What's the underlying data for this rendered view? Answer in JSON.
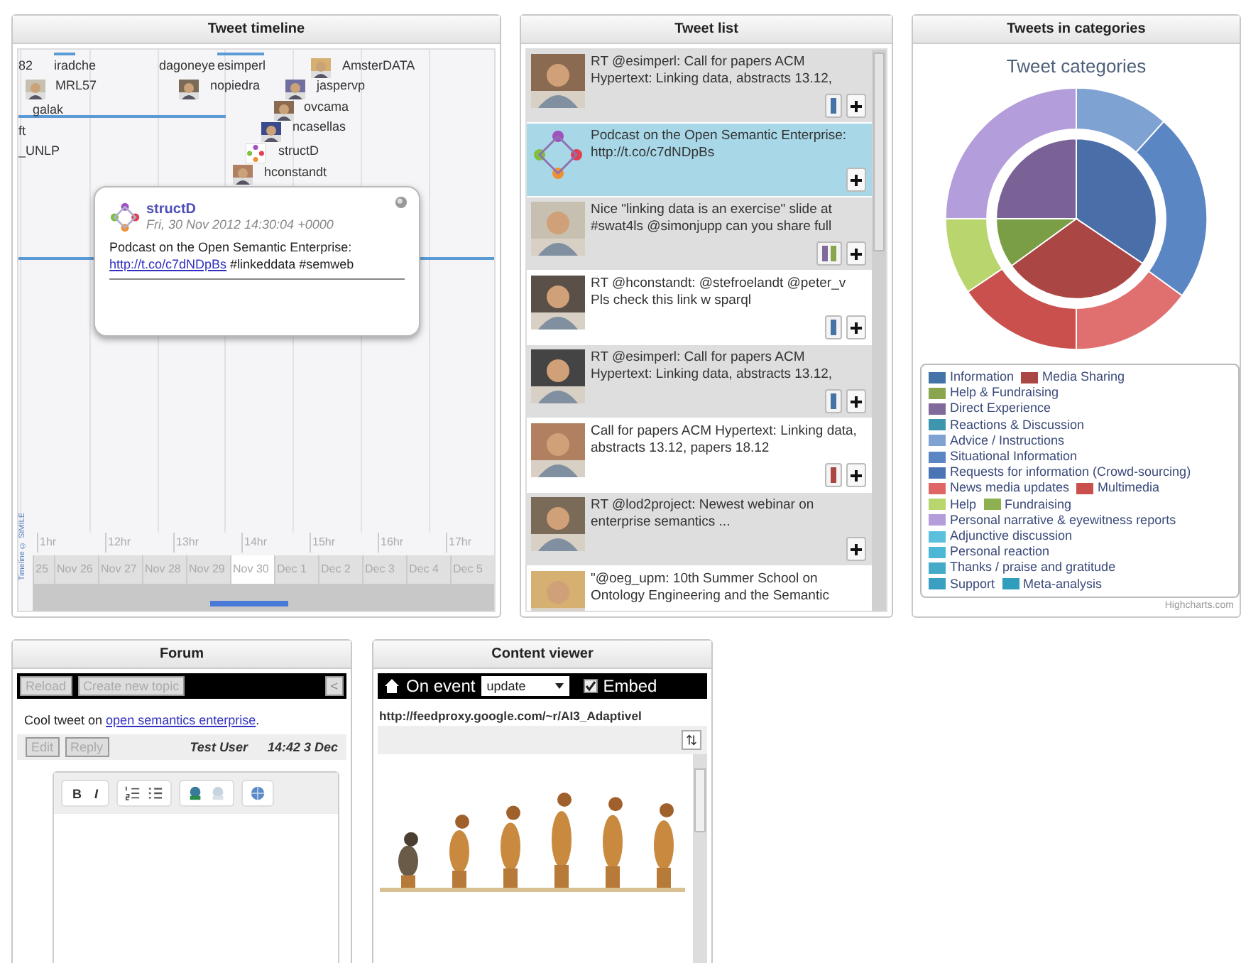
{
  "timeline": {
    "title": "Tweet timeline",
    "events": [
      {
        "label": "82"
      },
      {
        "label": "iradche"
      },
      {
        "label": "MRL57"
      },
      {
        "label": "galak"
      },
      {
        "label": "dagoneye"
      },
      {
        "label": "esimperl"
      },
      {
        "label": "nopiedra"
      },
      {
        "label": "AmsterDATA"
      },
      {
        "label": "jaspervp"
      },
      {
        "label": "ovcama"
      },
      {
        "label": "ncasellas"
      },
      {
        "label": "ft"
      },
      {
        "label": "_UNLP"
      },
      {
        "label": "structD"
      },
      {
        "label": "hconstandt"
      }
    ],
    "popup": {
      "user": "structD",
      "date": "Fri, 30 Nov 2012 14:30:04 +0000",
      "text": "Podcast on the Open Semantic Enterprise: ",
      "link": "http://t.co/c7dNDpBs",
      "after": " #linkeddata #semweb"
    },
    "hour_ticks": [
      "1hr",
      "12hr",
      "13hr",
      "14hr",
      "15hr",
      "16hr",
      "17hr"
    ],
    "date_ticks": [
      {
        "label": "25",
        "selected": false
      },
      {
        "label": "Nov 26",
        "selected": false
      },
      {
        "label": "Nov 27",
        "selected": false
      },
      {
        "label": "Nov 28",
        "selected": false
      },
      {
        "label": "Nov 29",
        "selected": false
      },
      {
        "label": "Nov 30",
        "selected": true
      },
      {
        "label": "Dec 1",
        "selected": false
      },
      {
        "label": "Dec 2",
        "selected": false
      },
      {
        "label": "Dec 3",
        "selected": false
      },
      {
        "label": "Dec 4",
        "selected": false
      },
      {
        "label": "Dec 5",
        "selected": false
      }
    ],
    "credit": "Timeline © SIMILE"
  },
  "tweet_list": {
    "title": "Tweet list",
    "items": [
      {
        "text": "RT @esimperl: Call for papers ACM Hypertext: Linking data, abstracts 13.12,",
        "tags": [
          {
            "color": "#4572a7"
          }
        ],
        "selected": false
      },
      {
        "kind": "logo",
        "text": "Podcast on the Open Semantic Enterprise: http://t.co/c7dNDpBs",
        "selected": true
      },
      {
        "text": "Nice \"linking data is an exercise\" slide at #swat4ls @simonjupp can you share full",
        "tags": [
          {
            "color": "#80699b"
          },
          {
            "color": "#89a54e"
          }
        ],
        "selected": false
      },
      {
        "text": "RT @hconstandt: @stefroelandt @peter_v Pls check this link w sparql",
        "tags": [
          {
            "color": "#4572a7"
          }
        ],
        "selected": false
      },
      {
        "text": "RT @esimperl: Call for papers ACM Hypertext: Linking data, abstracts 13.12,",
        "tags": [
          {
            "color": "#4572a7"
          }
        ],
        "selected": false
      },
      {
        "text": "Call for papers ACM Hypertext: Linking data, abstracts 13.12, papers 18.12",
        "tags": [
          {
            "color": "#aa4643"
          }
        ],
        "selected": false
      },
      {
        "text": "RT @lod2project: Newest webinar on enterprise semantics ...",
        "selected": false
      },
      {
        "text": "\"@oeg_upm: 10th Summer School on Ontology Engineering and the Semantic",
        "selected": false
      }
    ]
  },
  "categories": {
    "title": "Tweets in categories",
    "chart_title": "Tweet categories",
    "legend": [
      [
        {
          "label": "Information",
          "color": "#4572a7"
        },
        {
          "label": "Media Sharing",
          "color": "#aa4643"
        }
      ],
      [
        {
          "label": "Help & Fundraising",
          "color": "#89a54e"
        }
      ],
      [
        {
          "label": "Direct Experience",
          "color": "#80699b"
        }
      ],
      [
        {
          "label": "Reactions & Discussion",
          "color": "#3d96ae"
        }
      ],
      [
        {
          "label": "Advice / Instructions",
          "color": "#7ea3d3"
        }
      ],
      [
        {
          "label": "Situational Information",
          "color": "#5b86c4"
        }
      ],
      [
        {
          "label": "Requests for information (Crowd-sourcing)",
          "color": "#4a74b3"
        }
      ],
      [
        {
          "label": "News media updates",
          "color": "#e06666"
        },
        {
          "label": "Multimedia",
          "color": "#c9504c"
        }
      ],
      [
        {
          "label": "Help",
          "color": "#b9d66e"
        },
        {
          "label": "Fundraising",
          "color": "#8db050"
        }
      ],
      [
        {
          "label": "Personal narrative & eyewitness reports",
          "color": "#b39ddb"
        }
      ],
      [
        {
          "label": "Adjunctive discussion",
          "color": "#5bc0de"
        }
      ],
      [
        {
          "label": "Personal reaction",
          "color": "#4db8d6"
        }
      ],
      [
        {
          "label": "Thanks / praise and gratitude",
          "color": "#45aac8"
        }
      ],
      [
        {
          "label": "Support",
          "color": "#3a9fc0"
        },
        {
          "label": "Meta-analysis",
          "color": "#2f9dbb"
        }
      ]
    ],
    "credit": "Highcharts.com"
  },
  "forum": {
    "title": "Forum",
    "toolbar": [
      {
        "label": "Reload",
        "disabled": true
      },
      {
        "label": "Create new topic",
        "disabled": true
      }
    ],
    "collapse": "<",
    "post": {
      "text": "Cool tweet on ",
      "link": "open semantics enterprise",
      "after": "."
    },
    "actions": [
      {
        "label": "Edit",
        "disabled": true
      },
      {
        "label": "Reply",
        "disabled": true
      }
    ],
    "author": "Test User",
    "time": "14:42 3 Dec",
    "editor_groups": [
      [
        {
          "kind": "bold",
          "label": "B"
        },
        {
          "kind": "italic",
          "label": "I"
        }
      ],
      [
        {
          "kind": "ordered-list"
        },
        {
          "kind": "bullet-list"
        }
      ],
      [
        {
          "kind": "link",
          "disabled": false
        },
        {
          "kind": "unlink",
          "disabled": true
        }
      ],
      [
        {
          "kind": "globe"
        }
      ]
    ]
  },
  "content_viewer": {
    "title": "Content viewer",
    "event_label": "On event",
    "event_select": "update",
    "embed": {
      "label": "Embed",
      "checked": true
    },
    "url": "http://feedproxy.google.com/~r/AI3_Adaptivel"
  }
}
